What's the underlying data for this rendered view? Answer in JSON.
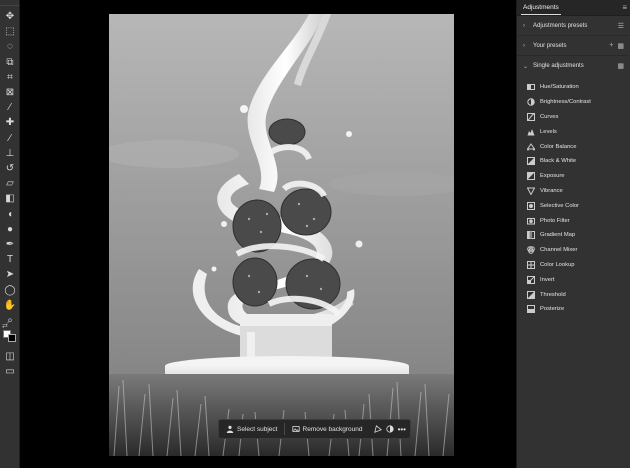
{
  "toolbar": {
    "tools": [
      {
        "name": "move-tool",
        "glyph": "✥"
      },
      {
        "name": "marquee-tool",
        "glyph": "⬚"
      },
      {
        "name": "lasso-tool",
        "glyph": "◌"
      },
      {
        "name": "object-selection-tool",
        "glyph": "⧉"
      },
      {
        "name": "crop-tool",
        "glyph": "⌗"
      },
      {
        "name": "frame-tool",
        "glyph": "⊠"
      },
      {
        "name": "eyedropper-tool",
        "glyph": "⁄"
      },
      {
        "name": "healing-brush-tool",
        "glyph": "✚"
      },
      {
        "name": "brush-tool",
        "glyph": "∕"
      },
      {
        "name": "clone-stamp-tool",
        "glyph": "⊥"
      },
      {
        "name": "history-brush-tool",
        "glyph": "↺"
      },
      {
        "name": "eraser-tool",
        "glyph": "▱"
      },
      {
        "name": "gradient-tool",
        "glyph": "◧"
      },
      {
        "name": "blur-tool",
        "glyph": "◖"
      },
      {
        "name": "dodge-tool",
        "glyph": "●"
      },
      {
        "name": "pen-tool",
        "glyph": "✒"
      },
      {
        "name": "type-tool",
        "glyph": "T"
      },
      {
        "name": "path-selection-tool",
        "glyph": "➤"
      },
      {
        "name": "shape-tool",
        "glyph": "◯"
      },
      {
        "name": "hand-tool",
        "glyph": "✋"
      },
      {
        "name": "zoom-tool",
        "glyph": "⌕"
      },
      {
        "name": "more-tools",
        "glyph": "•••"
      }
    ],
    "bottom_tools": [
      {
        "name": "quick-mask-button",
        "glyph": "◫"
      },
      {
        "name": "screen-mode-button",
        "glyph": "▭"
      }
    ]
  },
  "taskbar": {
    "select_subject": "Select subject",
    "remove_background": "Remove background"
  },
  "panel": {
    "tab": "Adjustments",
    "sections": [
      {
        "label": "Adjustments presets",
        "expanded": false
      },
      {
        "label": "Your presets",
        "expanded": false
      },
      {
        "label": "Single adjustments",
        "expanded": true
      }
    ],
    "adjustments": [
      {
        "label": "Hue/Saturation",
        "icon": "hue-saturation-icon"
      },
      {
        "label": "Brightness/Contrast",
        "icon": "brightness-contrast-icon"
      },
      {
        "label": "Curves",
        "icon": "curves-icon"
      },
      {
        "label": "Levels",
        "icon": "levels-icon"
      },
      {
        "label": "Color Balance",
        "icon": "color-balance-icon"
      },
      {
        "label": "Black & White",
        "icon": "black-white-icon"
      },
      {
        "label": "Exposure",
        "icon": "exposure-icon"
      },
      {
        "label": "Vibrance",
        "icon": "vibrance-icon"
      },
      {
        "label": "Selective Color",
        "icon": "selective-color-icon"
      },
      {
        "label": "Photo Filter",
        "icon": "photo-filter-icon"
      },
      {
        "label": "Gradient Map",
        "icon": "gradient-map-icon"
      },
      {
        "label": "Channel Mixer",
        "icon": "channel-mixer-icon"
      },
      {
        "label": "Color Lookup",
        "icon": "color-lookup-icon"
      },
      {
        "label": "Invert",
        "icon": "invert-icon"
      },
      {
        "label": "Threshold",
        "icon": "threshold-icon"
      },
      {
        "label": "Posterize",
        "icon": "posterize-icon"
      }
    ]
  }
}
